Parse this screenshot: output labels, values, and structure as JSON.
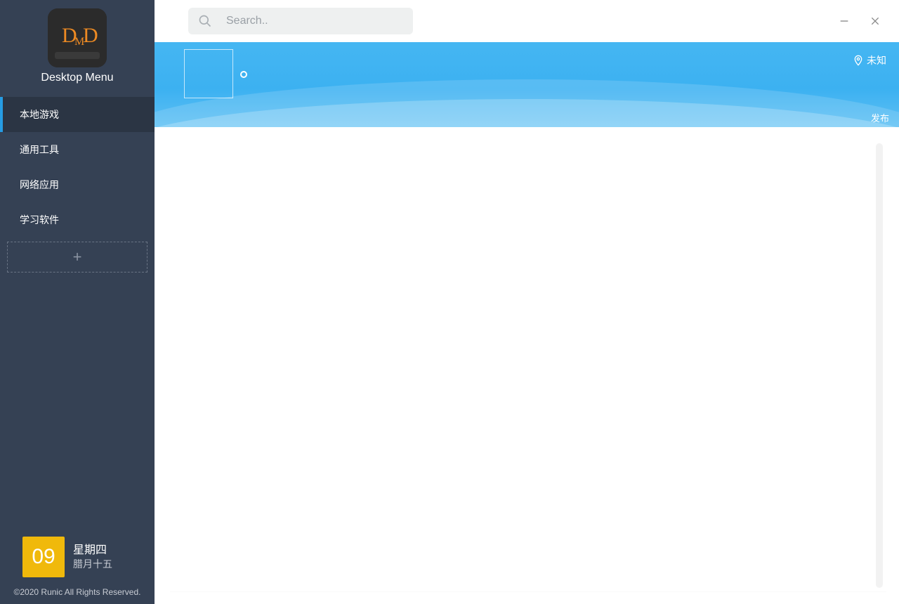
{
  "app": {
    "name": "Desktop Menu",
    "logo": {
      "letters": "DMD"
    }
  },
  "sidebar": {
    "items": [
      {
        "label": "本地游戏",
        "active": true
      },
      {
        "label": "通用工具",
        "active": false
      },
      {
        "label": "网络应用",
        "active": false
      },
      {
        "label": "学习软件",
        "active": false
      }
    ],
    "add_label": "+"
  },
  "date": {
    "day": "09",
    "weekday": "星期四",
    "lunar": "腊月十五"
  },
  "copyright": "©2020 Runic All Rights Reserved.",
  "search": {
    "placeholder": "Search..",
    "value": ""
  },
  "hero": {
    "location_label": "未知",
    "publish_label": "发布"
  },
  "icons": {
    "search": "search-icon",
    "minimize": "minimize-icon",
    "close": "close-icon",
    "location": "location-pin-icon",
    "plus": "plus-icon"
  },
  "colors": {
    "sidebar_bg": "#354154",
    "accent_blue": "#269ce4",
    "hero_blue": "#3cb1f1",
    "date_badge": "#f0b90b",
    "logo_orange": "#ec8a23"
  }
}
